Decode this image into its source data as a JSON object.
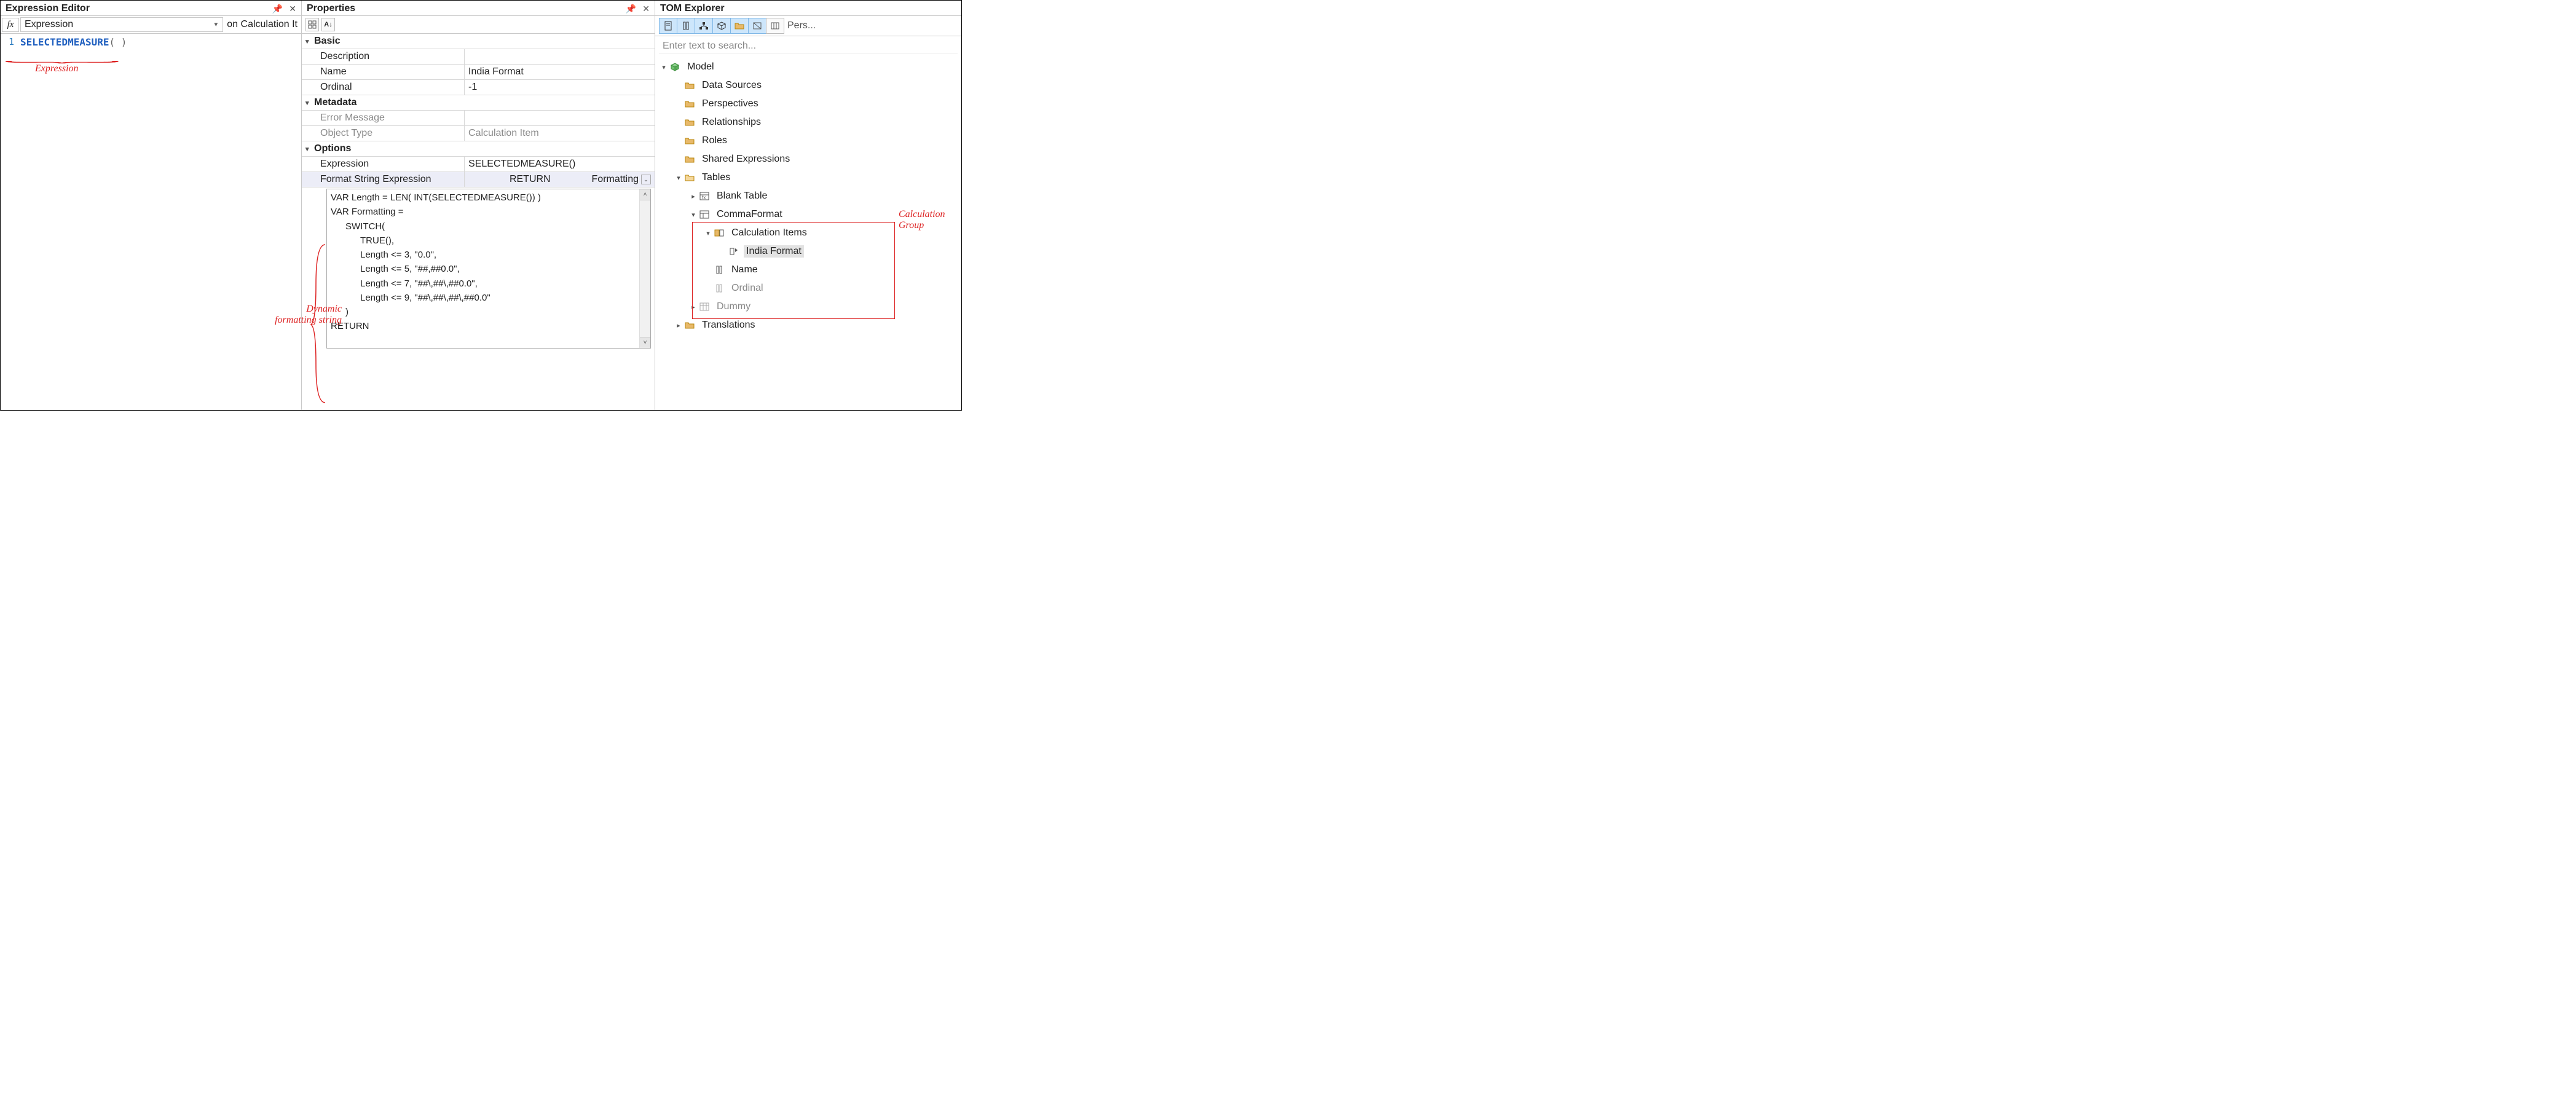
{
  "expression_editor": {
    "title": "Expression Editor",
    "fx_label": "fx",
    "dropdown_label": "Expression",
    "context_note": "on Calculation It",
    "line_number": "1",
    "code_fn": "SELECTEDMEASURE",
    "code_parens": "( )",
    "annotation": "Expression"
  },
  "properties": {
    "title": "Properties",
    "sections": {
      "basic": "Basic",
      "metadata": "Metadata",
      "options": "Options"
    },
    "rows": {
      "description_k": "Description",
      "description_v": "",
      "name_k": "Name",
      "name_v": "India Format",
      "ordinal_k": "Ordinal",
      "ordinal_v": "-1",
      "error_k": "Error Message",
      "error_v": "",
      "otype_k": "Object Type",
      "otype_v": "Calculation Item",
      "expr_k": "Expression",
      "expr_v": "SELECTEDMEASURE()",
      "fse_k": "Format String Expression",
      "fse_mid": "RETURN",
      "fse_right": "Formatting"
    },
    "fse_lines": [
      "VAR Length = LEN( INT(SELECTEDMEASURE()) )",
      "VAR Formatting =",
      "    SWITCH(",
      "        TRUE(),",
      "        Length <= 3, \"0.0\",",
      "        Length <= 5, \"##,##0.0\",",
      "        Length <= 7, \"##\\,##\\,##0.0\",",
      "        Length <= 9, \"##\\,##\\,##\\,##0.0\"",
      "    )",
      "RETURN"
    ],
    "annotation_l1": "Dynamic",
    "annotation_l2": "formatting string"
  },
  "tom": {
    "title": "TOM Explorer",
    "toolbar_text": "Pers...",
    "search_placeholder": "Enter text to search...",
    "nodes": {
      "model": "Model",
      "data_sources": "Data Sources",
      "perspectives": "Perspectives",
      "relationships": "Relationships",
      "roles": "Roles",
      "shared_expr": "Shared Expressions",
      "tables": "Tables",
      "blank_table": "Blank Table",
      "comma_format": "CommaFormat",
      "calc_items": "Calculation Items",
      "india_format": "India Format",
      "name": "Name",
      "ordinal": "Ordinal",
      "dummy": "Dummy",
      "translations": "Translations"
    },
    "annotation_l1": "Calculation",
    "annotation_l2": "Group"
  }
}
